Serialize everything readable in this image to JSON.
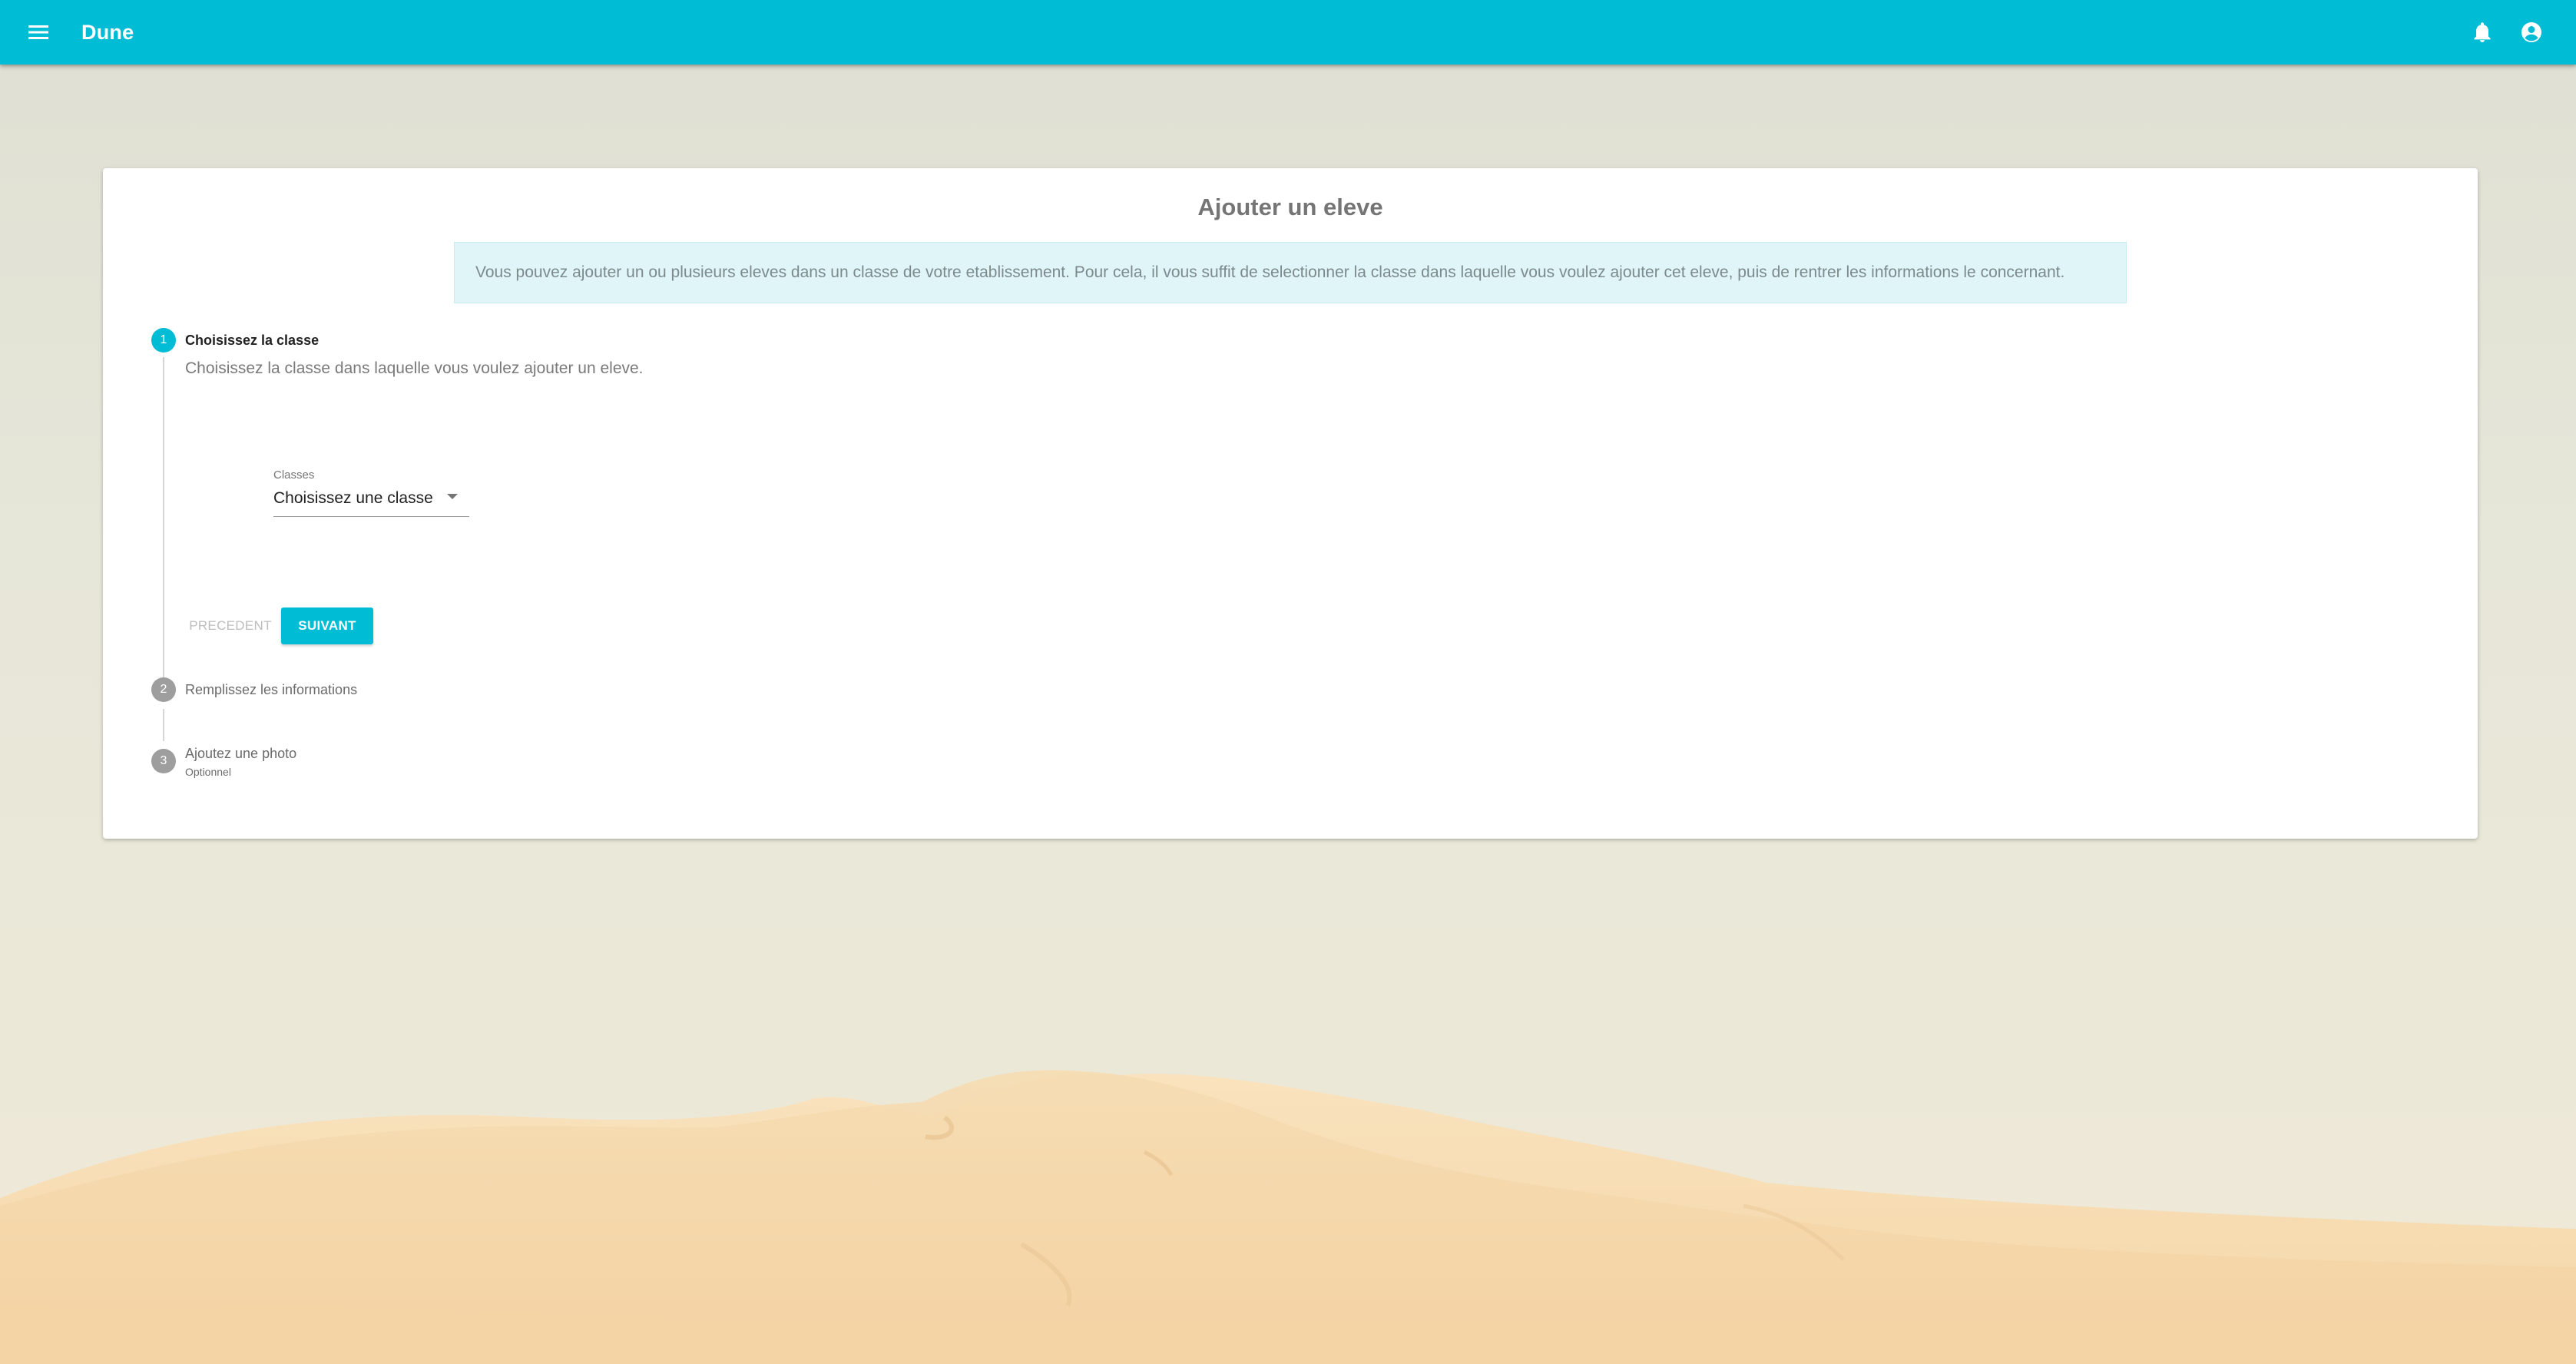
{
  "colors": {
    "primary": "#00bcd4",
    "inactive_step": "#9e9e9e",
    "info_background": "#e0f5f8",
    "sand": "#f7dcb0"
  },
  "appbar": {
    "title": "Dune",
    "menu_icon": "menu-icon",
    "notification_icon": "bell-icon",
    "account_icon": "account-circle-icon"
  },
  "card": {
    "title": "Ajouter un eleve",
    "info": "Vous pouvez ajouter un ou plusieurs eleves dans un classe de votre etablissement. Pour cela, il vous suffit de selectionner la classe dans laquelle vous voulez ajouter cet eleve, puis de rentrer les informations le concernant."
  },
  "stepper": {
    "steps": [
      {
        "number": "1",
        "title": "Choisissez la classe",
        "description": "Choisissez la classe dans laquelle vous voulez ajouter un eleve.",
        "active": true
      },
      {
        "number": "2",
        "title": "Remplissez les informations",
        "active": false
      },
      {
        "number": "3",
        "title": "Ajoutez une photo",
        "optional": "Optionnel",
        "active": false
      }
    ],
    "class_select": {
      "label": "Classes",
      "value": "Choisissez une classe"
    },
    "buttons": {
      "previous": "PRECEDENT",
      "next": "SUIVANT"
    }
  }
}
